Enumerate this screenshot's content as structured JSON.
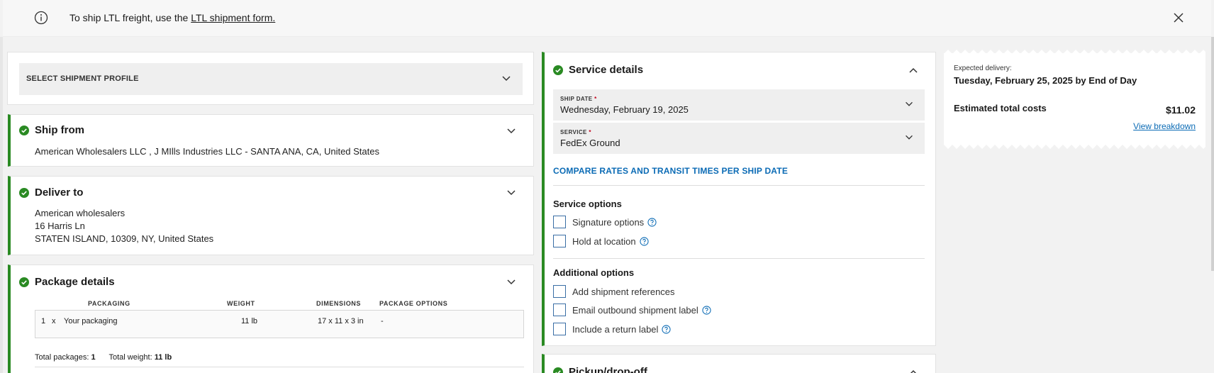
{
  "banner": {
    "message_prefix": "To ship LTL freight, use the ",
    "link": "LTL shipment form."
  },
  "profile": {
    "label": "SELECT SHIPMENT PROFILE"
  },
  "ship_from": {
    "title": "Ship from",
    "address": "American Wholesalers LLC , J MIlls Industries LLC - SANTA ANA, CA, United States"
  },
  "deliver_to": {
    "title": "Deliver to",
    "lines": [
      "American wholesalers",
      "16 Harris Ln",
      "STATEN ISLAND, 10309, NY, United States"
    ]
  },
  "package": {
    "title": "Package details",
    "headers": {
      "packaging": "PACKAGING",
      "weight": "WEIGHT",
      "dimensions": "DIMENSIONS",
      "options": "PACKAGE OPTIONS"
    },
    "row": {
      "qty": "1",
      "x": "x",
      "packaging": "Your packaging",
      "weight": "11 lb",
      "dimensions": "17 x 11 x 3 in",
      "options": "-"
    },
    "total_packages_label": "Total packages:",
    "total_packages": "1",
    "total_weight_label": "Total weight:",
    "total_weight": "11 lb"
  },
  "service": {
    "title": "Service details",
    "ship_date_label": "SHIP DATE",
    "ship_date": "Wednesday, February 19, 2025",
    "service_label": "SERVICE",
    "service_value": "FedEx Ground",
    "required_mark": "*",
    "compare_link": "COMPARE RATES AND TRANSIT TIMES PER SHIP DATE",
    "service_options_title": "Service options",
    "service_options": [
      "Signature options",
      "Hold at location"
    ],
    "additional_options_title": "Additional options",
    "additional_options": [
      "Add shipment references",
      "Email outbound shipment label",
      "Include a return label"
    ]
  },
  "pickup": {
    "title": "Pickup/drop-off"
  },
  "summary": {
    "expected_label": "Expected delivery:",
    "expected_value": "Tuesday, February 25, 2025 by End of Day",
    "estimated_label": "Estimated total costs",
    "estimated_value": "$11.02",
    "view_breakdown": "View breakdown"
  },
  "colors": {
    "success": "#2a8a23",
    "link": "#0b6bb5",
    "checkbox_border": "#3a6ea5",
    "required": "#c0001a"
  },
  "icons": [
    "info-icon",
    "close-icon",
    "check-circle-icon",
    "chevron-down-icon",
    "chevron-up-icon",
    "help-icon"
  ]
}
